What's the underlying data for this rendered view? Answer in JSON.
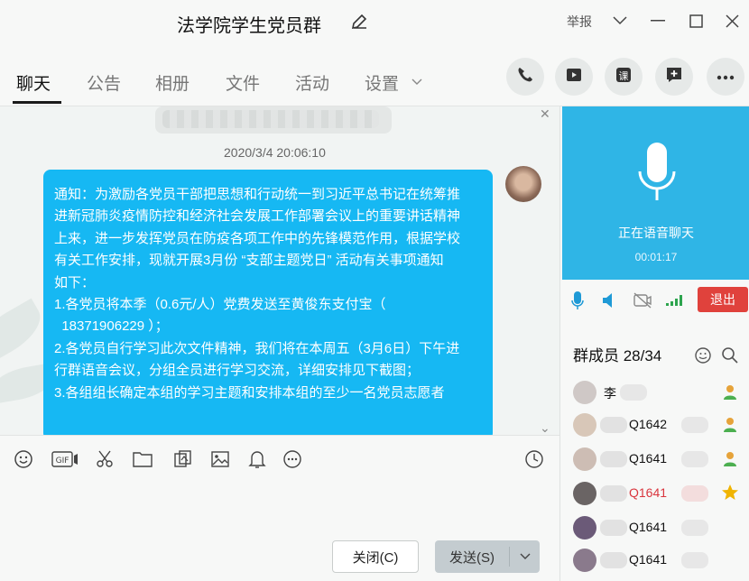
{
  "window": {
    "title": "法学院学生党员群",
    "report_label": "举报"
  },
  "tabs": [
    {
      "label": "聊天"
    },
    {
      "label": "公告"
    },
    {
      "label": "相册"
    },
    {
      "label": "文件"
    },
    {
      "label": "活动"
    },
    {
      "label": "设置"
    }
  ],
  "toolbar_icons": [
    "phone-icon",
    "video-icon",
    "course-icon",
    "add-app-icon",
    "more-icon"
  ],
  "chat": {
    "timestamp": "2020/3/4 20:06:10",
    "message": "通知：为激励各党员干部把思想和行动统一到习近平总书记在统筹推\n进新冠肺炎疫情防控和经济社会发展工作部署会议上的重要讲话精神\n上来，进一步发挥党员在防疫各项工作中的先锋模范作用，根据学校\n有关工作安排，现就开展3月份 “支部主题党日” 活动有关事项通知\n如下：\n1.各党员将本季（0.6元/人）党费发送至黄俊东支付宝（\n  18371906229 ）；\n2.各党员自行学习此次文件精神，我们将在本周五（3月6日）下午进\n行群语音会议，分组全员进行学习交流，详细安排见下截图；\n3.各组组长确定本组的学习主题和安排本组的至少一名党员志愿者"
  },
  "input_toolbar_icons": [
    "emoji-icon",
    "gif-icon",
    "scissors-icon",
    "folder-icon",
    "screenshot-icon",
    "image-icon",
    "bell-icon",
    "more-icon",
    "history-icon"
  ],
  "buttons": {
    "close": "关闭(C)",
    "send": "发送(S)"
  },
  "voice": {
    "status": "正在语音聊天",
    "timer": "00:01:17",
    "exit": "退出"
  },
  "members": {
    "title": "群成员 28/34",
    "list": [
      {
        "name": "李",
        "role": "member",
        "color": "#111111"
      },
      {
        "name": "Q1642",
        "role": "member",
        "color": "#111111"
      },
      {
        "name": "Q1641",
        "role": "member",
        "color": "#111111"
      },
      {
        "name": "Q1641",
        "role": "admin",
        "color": "#d9363e"
      },
      {
        "name": "Q1641",
        "role": "none",
        "color": "#111111"
      },
      {
        "name": "Q1641",
        "role": "none",
        "color": "#111111"
      }
    ]
  },
  "colors": {
    "bubble": "#16b8f3",
    "voice_panel": "#2fb5e6",
    "exit_button": "#e0423c"
  }
}
